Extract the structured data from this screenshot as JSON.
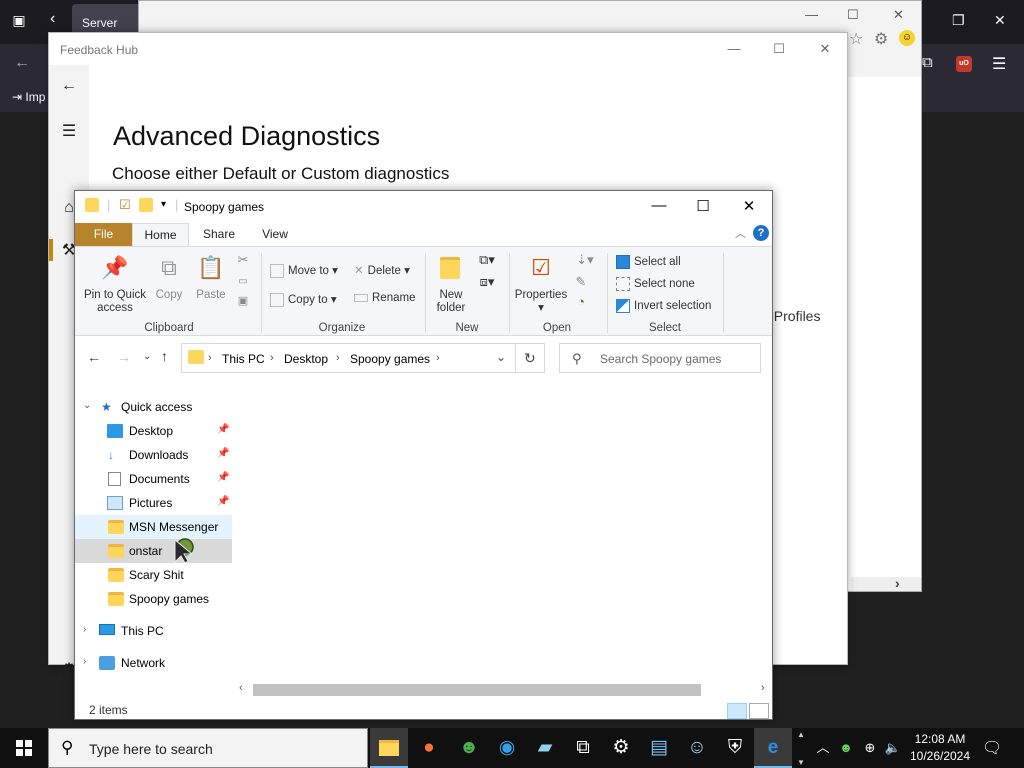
{
  "dark_browser": {
    "tab_label": "Server",
    "bookmark_label": "Imp"
  },
  "feedback_hub": {
    "title": "Feedback Hub",
    "heading": "Advanced Diagnostics",
    "subheading": "Choose either Default or Custom diagnostics",
    "partial_text": "eProfiles"
  },
  "explorer": {
    "title": "Spoopy games",
    "tabs": {
      "file": "File",
      "home": "Home",
      "share": "Share",
      "view": "View"
    },
    "ribbon": {
      "pin_to_quick_access": "Pin to Quick access",
      "copy": "Copy",
      "paste": "Paste",
      "move_to": "Move to",
      "copy_to": "Copy to",
      "delete": "Delete",
      "rename": "Rename",
      "new_folder": "New folder",
      "properties": "Properties",
      "select_all": "Select all",
      "select_none": "Select none",
      "invert_selection": "Invert selection",
      "groups": {
        "clipboard": "Clipboard",
        "organize": "Organize",
        "new": "New",
        "open": "Open",
        "select": "Select"
      }
    },
    "address": {
      "crumbs": [
        "This PC",
        "Desktop",
        "Spoopy games"
      ]
    },
    "search_placeholder": "Search Spoopy games",
    "nav": {
      "quick_access": "Quick access",
      "desktop": "Desktop",
      "downloads": "Downloads",
      "documents": "Documents",
      "pictures": "Pictures",
      "msn_messenger": "MSN Messenger",
      "onstar": "onstar",
      "scary_shit": "Scary Shit",
      "spoopy_games": "Spoopy games",
      "this_pc": "This PC",
      "network": "Network"
    },
    "status": "2 items"
  },
  "taskbar": {
    "search_placeholder": "Type here to search",
    "time": "12:08 AM",
    "date": "10/26/2024"
  },
  "colors": {
    "file_tab": "#b8842b",
    "folder": "#ffd65c",
    "taskbar": "#101010",
    "accent_blue": "#1e6fc7"
  }
}
